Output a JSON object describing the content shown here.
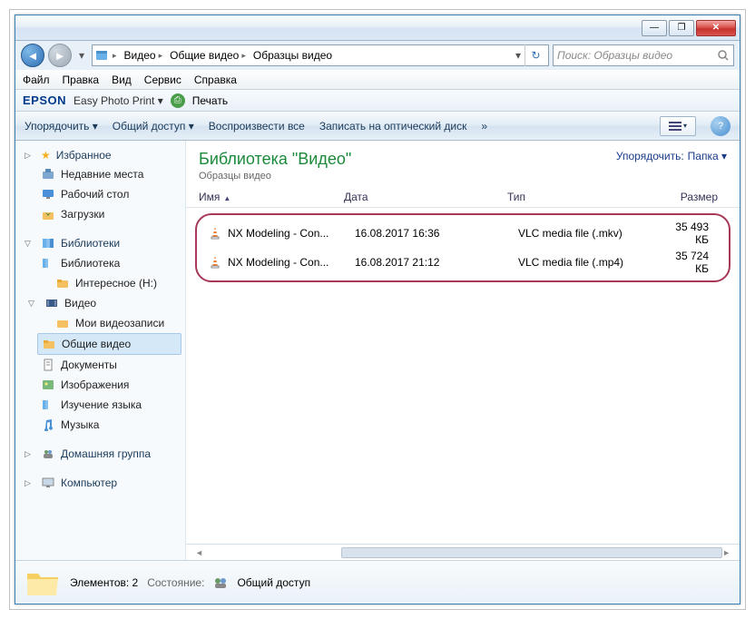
{
  "titlebar": {
    "min": "—",
    "max": "❐",
    "close": "✕"
  },
  "nav": {
    "back": "◄",
    "fwd": "►"
  },
  "breadcrumb": {
    "items": [
      "Видео",
      "Общие видео",
      "Образцы видео"
    ]
  },
  "search": {
    "placeholder": "Поиск: Образцы видео"
  },
  "menu": {
    "file": "Файл",
    "edit": "Правка",
    "view": "Вид",
    "tools": "Сервис",
    "help": "Справка"
  },
  "epson": {
    "logo": "EPSON",
    "easy": "Easy Photo Print",
    "print": "Печать"
  },
  "toolbar": {
    "organize": "Упорядочить",
    "share": "Общий доступ",
    "play": "Воспроизвести все",
    "burn": "Записать на оптический диск",
    "more": "»"
  },
  "side": {
    "fav": {
      "h": "Избранное",
      "items": [
        "Недавние места",
        "Рабочий стол",
        "Загрузки"
      ]
    },
    "lib": {
      "h": "Библиотеки",
      "items": [
        "Библиотека",
        "Интересное (H:)",
        "Видео",
        "Мои видеозаписи",
        "Общие видео",
        "Документы",
        "Изображения",
        "Изучение языка",
        "Музыка"
      ]
    },
    "home": {
      "h": "Домашняя группа"
    },
    "comp": {
      "h": "Компьютер"
    }
  },
  "header": {
    "title": "Библиотека \"Видео\"",
    "sub": "Образцы видео",
    "arrange": "Упорядочить:",
    "folder": "Папка"
  },
  "cols": {
    "name": "Имя",
    "date": "Дата",
    "type": "Тип",
    "size": "Размер"
  },
  "files": [
    {
      "name": "NX Modeling - Con...",
      "date": "16.08.2017 16:36",
      "type": "VLC media file (.mkv)",
      "size": "35 493 КБ"
    },
    {
      "name": "NX Modeling - Con...",
      "date": "16.08.2017 21:12",
      "type": "VLC media file (.mp4)",
      "size": "35 724 КБ"
    }
  ],
  "status": {
    "count": "Элементов: 2",
    "state": "Состояние:",
    "shared": "Общий доступ"
  }
}
